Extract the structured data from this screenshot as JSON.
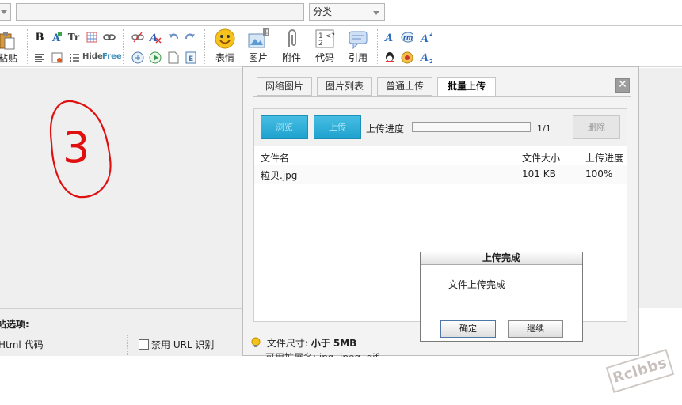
{
  "top": {
    "category_label": "分类",
    "title_value": ""
  },
  "toolbar": {
    "paste_label": "粘贴",
    "smiley_label": "表情",
    "image_label": "图片",
    "attach_label": "附件",
    "code_label": "代码",
    "quote_label": "引用",
    "hide_label": "Hide",
    "free_label": "Free",
    "bold_glyph": "B",
    "tt_glyph": "Tr"
  },
  "options": {
    "title": "帖选项:",
    "html_code": "Html 代码",
    "disable_url": "禁用 URL 识别"
  },
  "dialog": {
    "tabs": [
      "网络图片",
      "图片列表",
      "普通上传",
      "批量上传"
    ],
    "active_tab": "批量上传",
    "close_glyph": "✕",
    "browse_label": "浏览",
    "upload_label": "上传",
    "progress_label": "上传进度",
    "progress_count": "1/1",
    "progress_fraction": 1.0,
    "delete_label": "删除",
    "columns": [
      "文件名",
      "文件大小",
      "上传进度"
    ],
    "rows": [
      {
        "name": "粒贝.jpg",
        "size": "101 KB",
        "progress": "100%"
      }
    ],
    "hint_label": "文件尺寸:",
    "hint_value": "小于 5MB",
    "hint2": "可用扩展名: jpg, jpeg, gif"
  },
  "alert": {
    "title": "上传完成",
    "message": "文件上传完成",
    "ok_label": "确定",
    "continue_label": "继续"
  },
  "annotation_text": "3",
  "watermark": "Rclbbs",
  "colors": {
    "accent_blue": "#1fa2cf",
    "annotation_red": "#e01010"
  }
}
